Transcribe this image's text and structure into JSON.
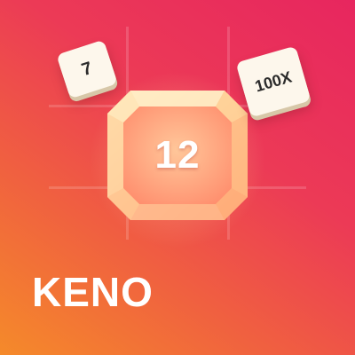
{
  "game": {
    "title": "KENO",
    "center_number": "12",
    "tiles": [
      {
        "label": "7"
      },
      {
        "label": "100X"
      }
    ]
  },
  "colors": {
    "background_top_right": "#e7265f",
    "background_bottom_left": "#f58a2a",
    "gem_core": "#ffb98a",
    "gem_edge": "#ffd9a8",
    "tile_face": "#fdf7ec",
    "text_light": "#ffffff",
    "text_dark": "#2b2b2b"
  },
  "icons": {
    "gem": "octagon-gem-icon"
  }
}
